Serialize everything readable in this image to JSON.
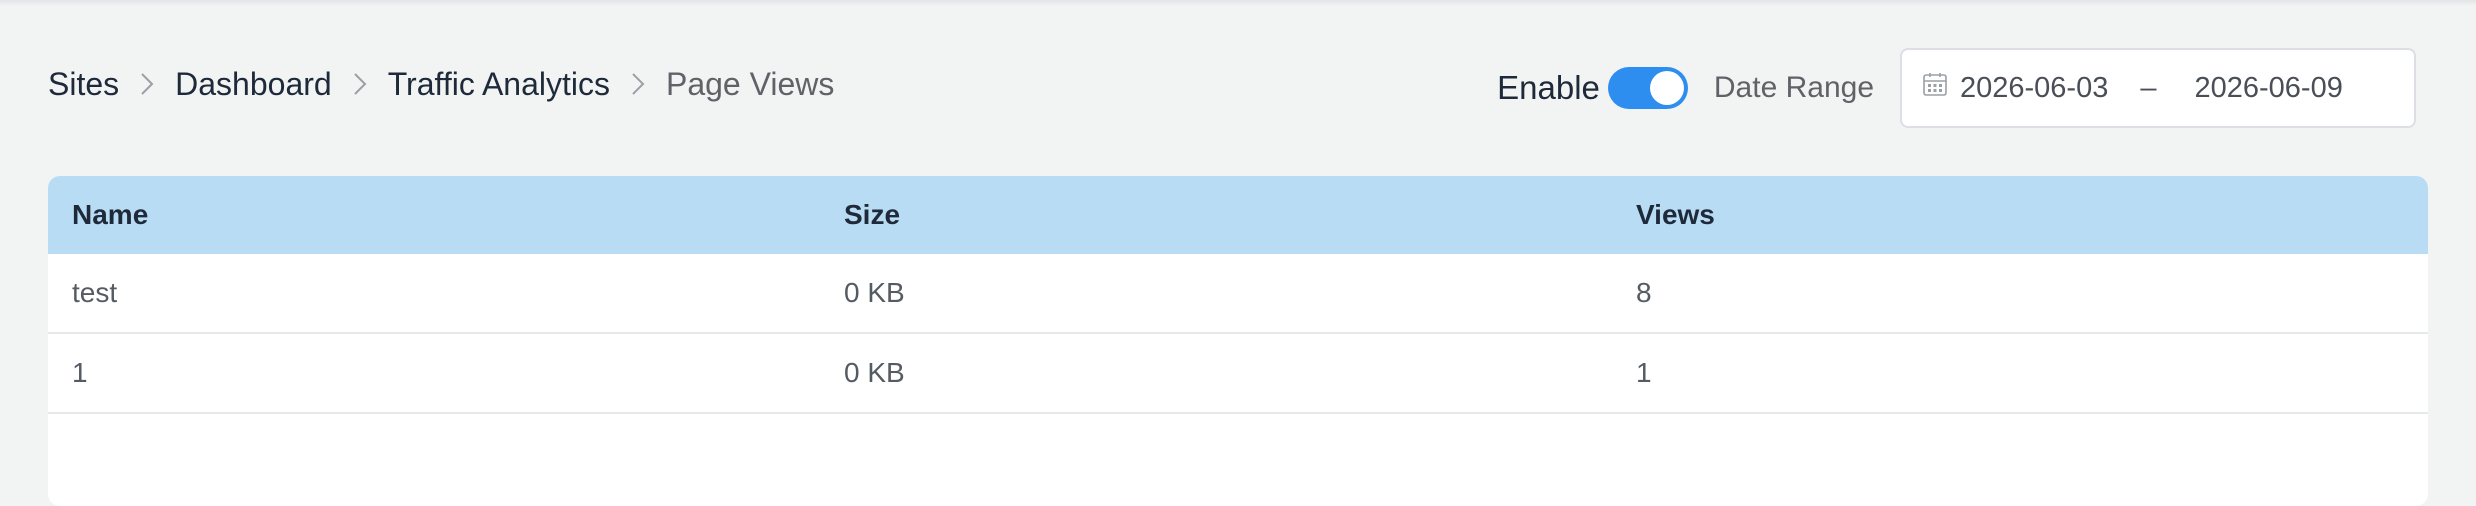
{
  "breadcrumb": {
    "items": [
      "Sites",
      "Dashboard",
      "Traffic Analytics"
    ],
    "current": "Page Views"
  },
  "controls": {
    "enable_label": "Enable",
    "enable_on": true,
    "date_range_label": "Date Range",
    "date_start": "2026-06-03",
    "date_separator": "–",
    "date_end": "2026-06-09"
  },
  "table": {
    "headers": [
      "Name",
      "Size",
      "Views"
    ],
    "rows": [
      [
        "test",
        "0 KB",
        "8"
      ],
      [
        "1",
        "0 KB",
        "1"
      ]
    ]
  },
  "colors": {
    "accent": "#2d8ef0",
    "header_bg": "#b9dcf5",
    "page_bg": "#f2f3f3"
  },
  "icons": {
    "separator": "chevron-right-icon",
    "date": "calendar-icon"
  }
}
